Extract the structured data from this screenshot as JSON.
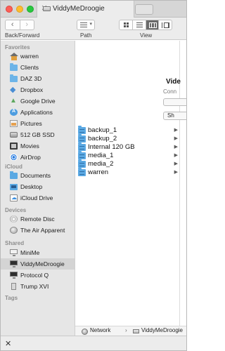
{
  "tab": {
    "title": "ViddyMeDroogie",
    "close": "✕"
  },
  "toolbar": {
    "back": "‹",
    "forward": "›",
    "back_forward_label": "Back/Forward",
    "path_label": "Path",
    "view_label": "View"
  },
  "sidebar": {
    "favorites_label": "Favorites",
    "favorites": [
      {
        "label": "warren",
        "icon": "home-icon"
      },
      {
        "label": "Clients",
        "icon": "folder-icon"
      },
      {
        "label": "DAZ 3D",
        "icon": "folder-icon"
      },
      {
        "label": "Dropbox",
        "icon": "dropbox-icon"
      },
      {
        "label": "Google Drive",
        "icon": "google-drive-icon"
      },
      {
        "label": "Applications",
        "icon": "applications-icon"
      },
      {
        "label": "Pictures",
        "icon": "pictures-icon"
      },
      {
        "label": "512 GB SSD",
        "icon": "disk-icon"
      },
      {
        "label": "Movies",
        "icon": "movies-icon"
      },
      {
        "label": "AirDrop",
        "icon": "airdrop-icon"
      }
    ],
    "icloud_label": "iCloud",
    "icloud": [
      {
        "label": "Documents",
        "icon": "documents-icon"
      },
      {
        "label": "Desktop",
        "icon": "desktop-icon"
      },
      {
        "label": "iCloud Drive",
        "icon": "icloud-drive-icon"
      }
    ],
    "devices_label": "Devices",
    "devices": [
      {
        "label": "Remote Disc",
        "icon": "disc-icon"
      },
      {
        "label": "The Air Apparent",
        "icon": "globe-icon"
      }
    ],
    "shared_label": "Shared",
    "shared": [
      {
        "label": "MiniMe",
        "icon": "monitor-icon"
      },
      {
        "label": "ViddyMeDroogie",
        "icon": "monitor-icon"
      },
      {
        "label": "Protocol Q",
        "icon": "monitor-icon"
      },
      {
        "label": "Trump XVI",
        "icon": "tower-icon"
      }
    ],
    "tags_label": "Tags"
  },
  "files": [
    "backup_1",
    "backup_2",
    "Internal 120 GB",
    "media_1",
    "media_2",
    "warren"
  ],
  "preview": {
    "name": "Vide",
    "status": "Conn",
    "button2": "Sh"
  },
  "pathbar": {
    "network": "Network",
    "separator": "›",
    "current": "ViddyMeDroogie"
  },
  "bottom": {
    "close": "✕"
  }
}
